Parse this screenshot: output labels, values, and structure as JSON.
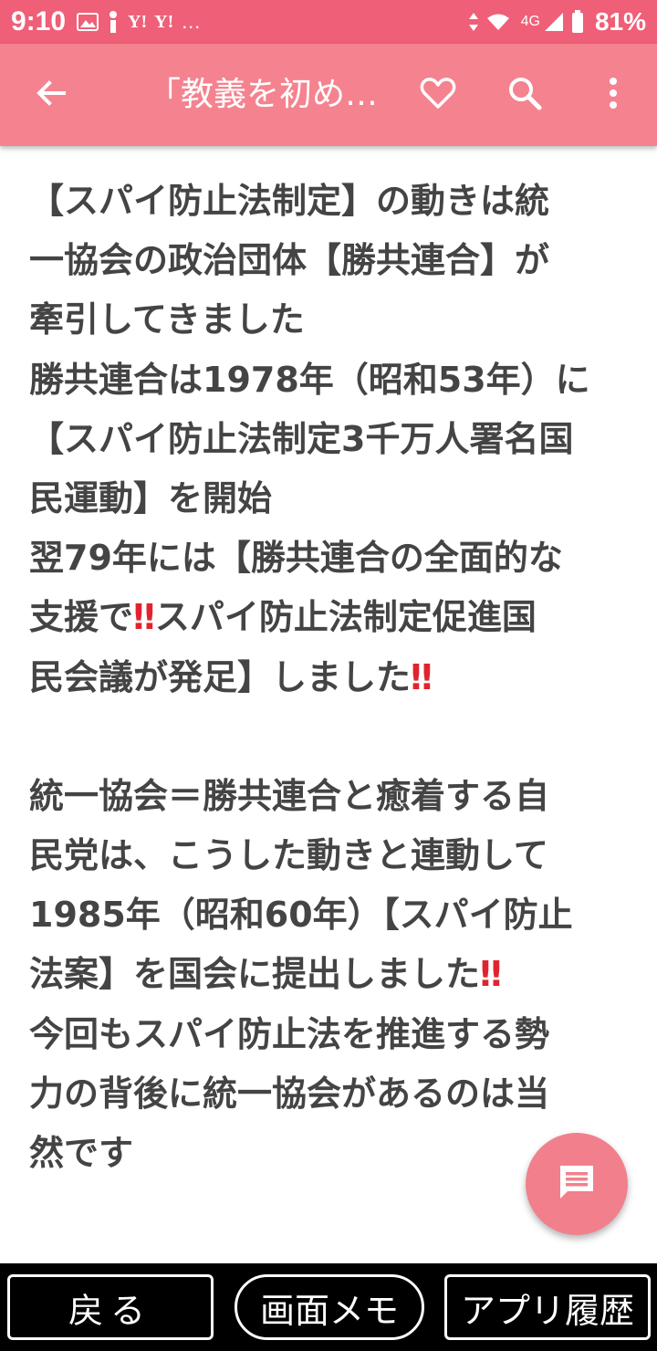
{
  "status_bar": {
    "time": "9:10",
    "yahoo1": "Y!",
    "yahoo2": "Y!",
    "more": "…",
    "network": "4G",
    "battery": "81%"
  },
  "app_bar": {
    "title": "「教義を初め…"
  },
  "content": {
    "lines": [
      "【スパイ防止法制定】の動きは統",
      "一協会の政治団体【勝共連合】が",
      "牽引してきました",
      "勝共連合は1978年（昭和53年）に",
      "【スパイ防止法制定3千万人署名国",
      "民運動】を開始",
      "翌79年には【勝共連合の全面的な",
      "支援で",
      "スパイ防止法制定促進国",
      "民会議が発足】しました",
      "統一協会＝勝共連合と癒着する自",
      "民党は、こうした動きと連動して",
      "1985年（昭和60年）【スパイ防止",
      "法案】を国会に提出しました",
      "今回もスパイ防止法を推進する勢",
      "力の背後に統一協会があるのは当",
      "然です"
    ],
    "emphasis": "‼"
  },
  "bottom_bar": {
    "back_label": "戻る",
    "memo_label": "画面メモ",
    "history_label": "アプリ履歴"
  },
  "icons": {
    "back": "arrow-left-icon",
    "favorite": "heart-outline-icon",
    "search": "search-icon",
    "menu": "more-vert-icon",
    "fab": "comment-icon"
  },
  "colors": {
    "status_bar": "#ef5f78",
    "app_bar": "#f4838f",
    "fab": "#f1808c",
    "text": "#444444",
    "emphasis": "#e0242f"
  }
}
